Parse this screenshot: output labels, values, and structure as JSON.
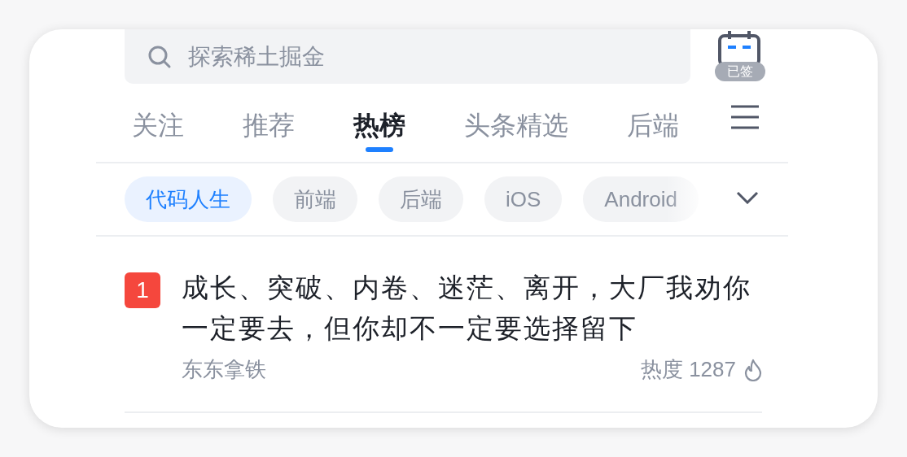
{
  "search": {
    "placeholder": "探索稀土掘金"
  },
  "checkin": {
    "label": "已签"
  },
  "tabs": [
    {
      "label": "关注",
      "selected": false
    },
    {
      "label": "推荐",
      "selected": false
    },
    {
      "label": "热榜",
      "selected": true
    },
    {
      "label": "头条精选",
      "selected": false
    },
    {
      "label": "后端",
      "selected": false
    }
  ],
  "chips": [
    {
      "label": "代码人生",
      "selected": true
    },
    {
      "label": "前端",
      "selected": false
    },
    {
      "label": "后端",
      "selected": false
    },
    {
      "label": "iOS",
      "selected": false
    },
    {
      "label": "Android",
      "selected": false
    }
  ],
  "articles": [
    {
      "rank": "1",
      "color": "#f5473d",
      "title": "成长、突破、内卷、迷茫、离开，大厂我劝你一定要去，但你却不一定要选择留下",
      "author": "东东拿铁",
      "heat": "热度 1287"
    }
  ]
}
